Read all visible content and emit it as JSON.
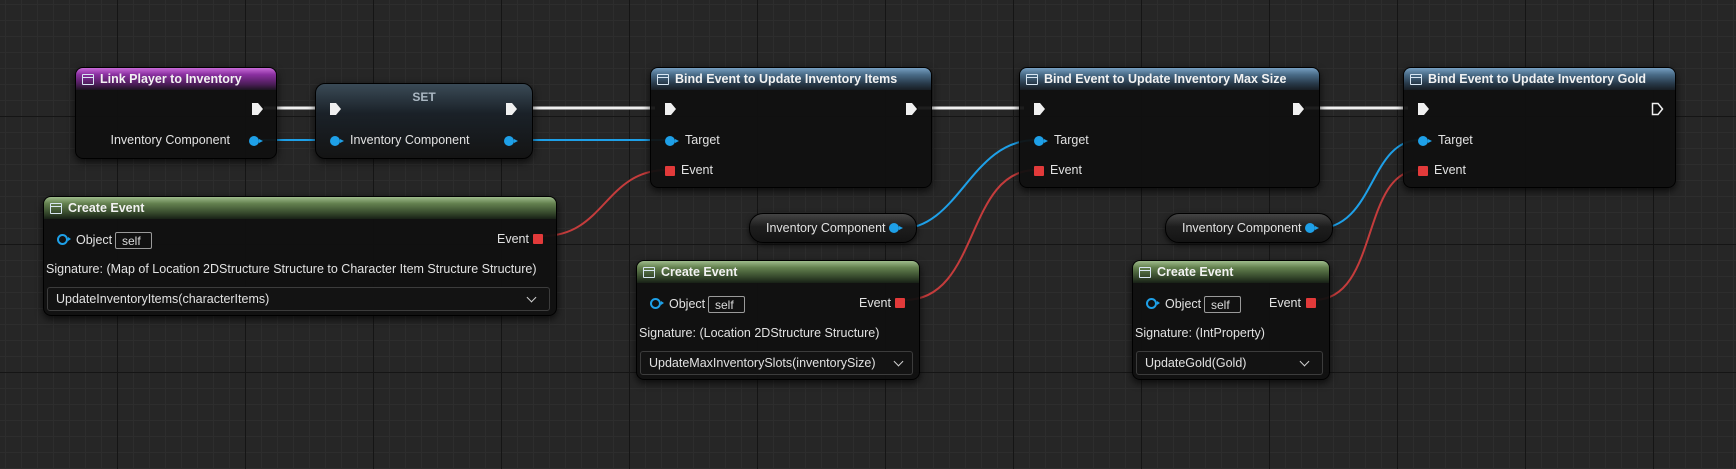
{
  "colors": {
    "grid_background": "#262626",
    "exec_wire": "#ffffff",
    "object_wire": "#1ea0e8",
    "delegate_wire": "#c43c3c",
    "function_header": "#4a6c88",
    "macro_header": "#8a2fa0",
    "event_header": "#63804e"
  },
  "link_player": {
    "title": "Link Player to Inventory",
    "icon": "function-icon",
    "out_pin": "Inventory Component"
  },
  "set_node": {
    "title": "SET",
    "in_pin": "Inventory Component"
  },
  "bind_items": {
    "title": "Bind Event to Update Inventory Items",
    "target": "Target",
    "event": "Event"
  },
  "bind_max": {
    "title": "Bind Event to Update Inventory Max Size",
    "target": "Target",
    "event": "Event"
  },
  "bind_gold": {
    "title": "Bind Event to Update Inventory Gold",
    "target": "Target",
    "event": "Event"
  },
  "getter_1": {
    "label": "Inventory Component"
  },
  "getter_2": {
    "label": "Inventory Component"
  },
  "create_event_1": {
    "title": "Create Event",
    "object_label": "Object",
    "object_value": "self",
    "event_label": "Event",
    "signature": "Signature: (Map of Location 2DStructure Structure to Character Item Structure Structure)",
    "function": "UpdateInventoryItems(characterItems)"
  },
  "create_event_2": {
    "title": "Create Event",
    "object_label": "Object",
    "object_value": "self",
    "event_label": "Event",
    "signature": "Signature: (Location 2DStructure Structure)",
    "function": "UpdateMaxInventorySlots(inventorySize)"
  },
  "create_event_3": {
    "title": "Create Event",
    "object_label": "Object",
    "object_value": "self",
    "event_label": "Event",
    "signature": "Signature: (IntProperty)",
    "function": "UpdateGold(Gold)"
  }
}
